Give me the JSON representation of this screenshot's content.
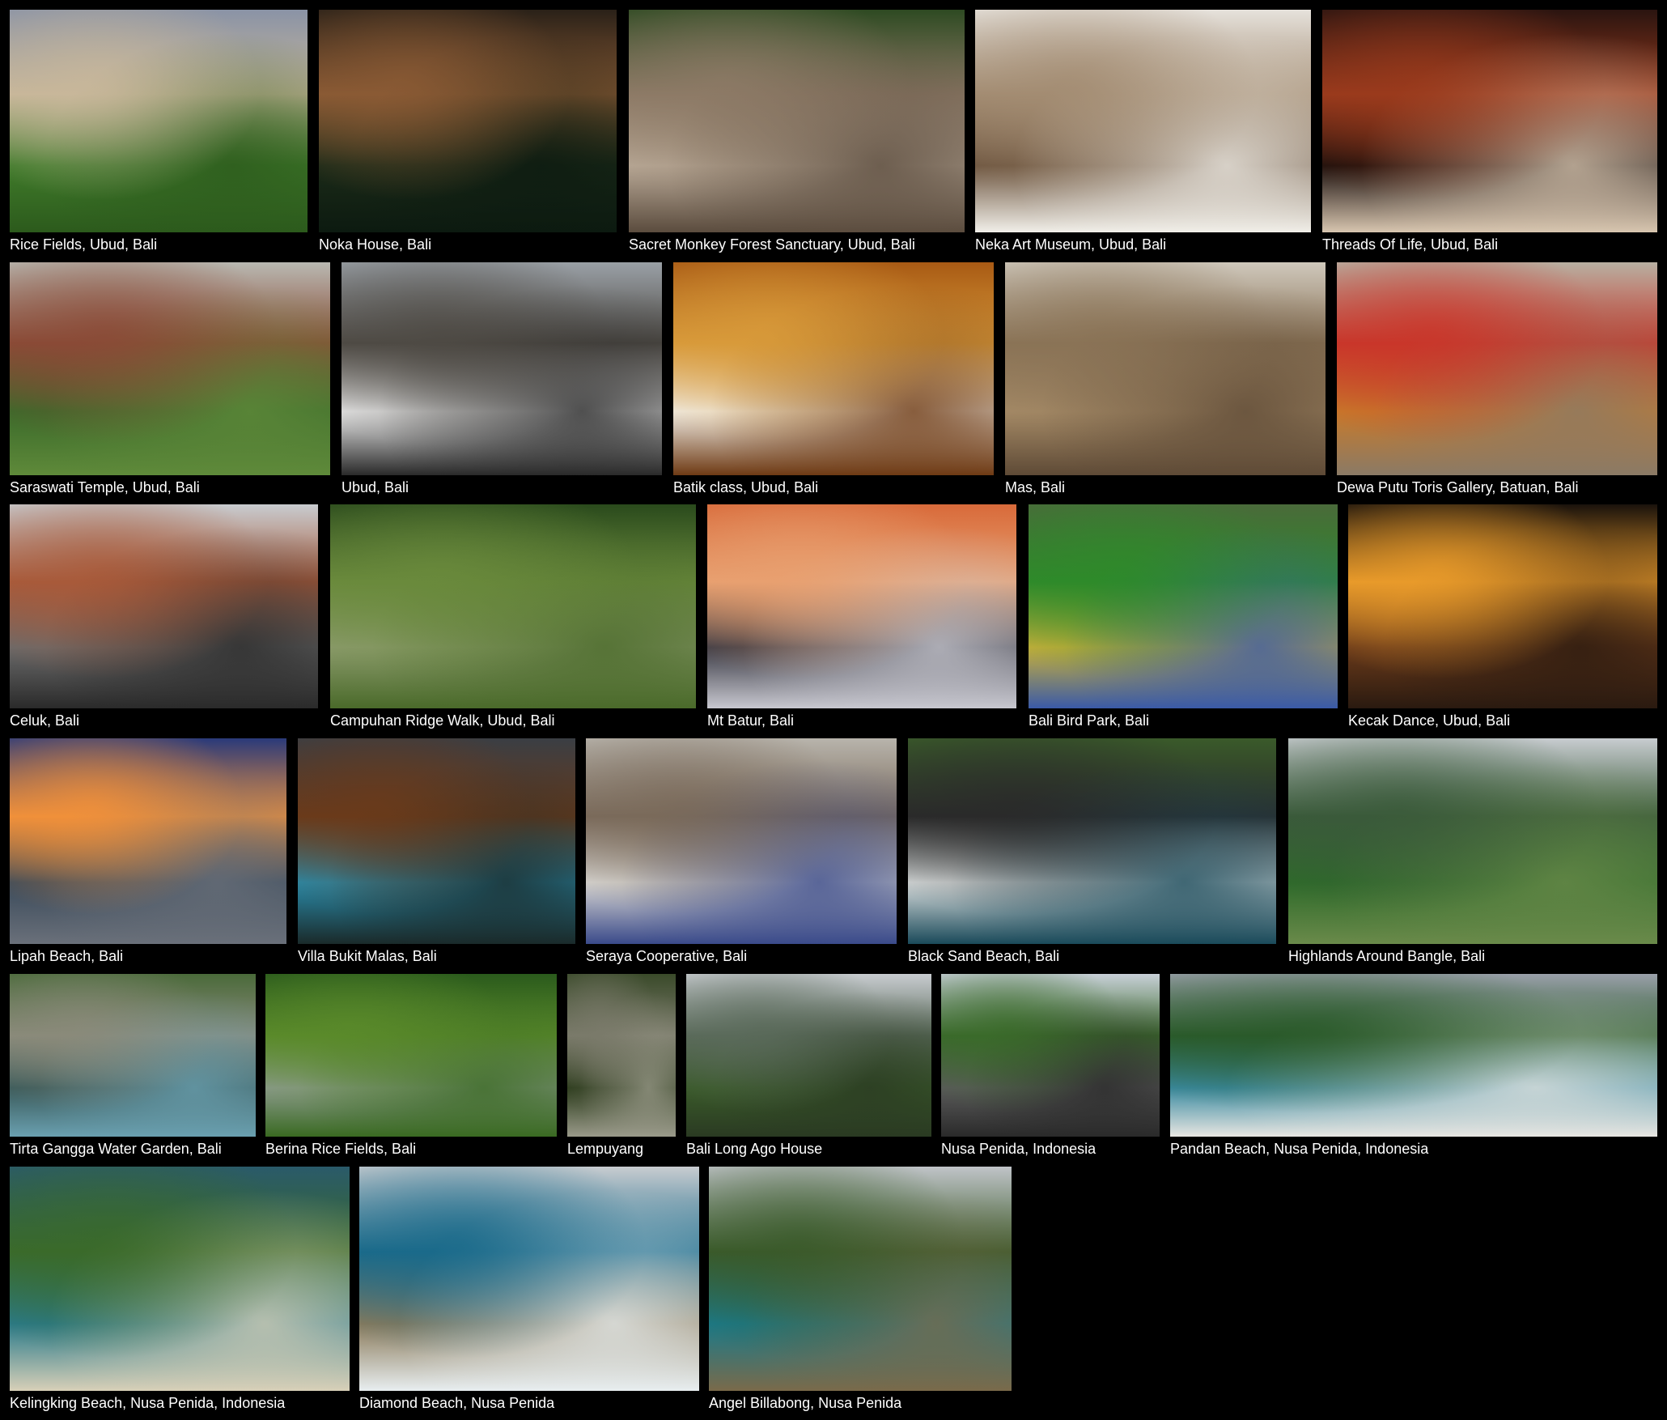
{
  "gallery": {
    "background": "#000000",
    "caption_color": "#ffffff",
    "rows": [
      {
        "tiles": [
          {
            "caption": "Rice Fields, Ubud, Bali",
            "colors": [
              "#8a93a6",
              "#c8b79a",
              "#3f7a2a",
              "#2c5a1c"
            ]
          },
          {
            "caption": "Noka House, Bali",
            "colors": [
              "#2a2118",
              "#8a5a34",
              "#1b2a18",
              "#0c1a10"
            ]
          },
          {
            "caption": "Sacret Monkey Forest Sanctuary, Ubud, Bali",
            "colors": [
              "#2e4a22",
              "#8d7a66",
              "#b8a896",
              "#5b4c3e"
            ]
          },
          {
            "caption": "Neka Art Museum, Ubud, Bali",
            "colors": [
              "#e6e2dc",
              "#a38c72",
              "#6e5640",
              "#f1efe9"
            ]
          },
          {
            "caption": "Threads Of Life, Ubud, Bali",
            "colors": [
              "#2a1410",
              "#9a3a1c",
              "#1a0f0c",
              "#d8c6b0"
            ]
          }
        ]
      },
      {
        "tiles": [
          {
            "caption": "Saraswati Temple, Ubud, Bali",
            "colors": [
              "#b9b9b2",
              "#8a4a36",
              "#3b6a2a",
              "#5f8a3a"
            ]
          },
          {
            "caption": "Ubud, Bali",
            "colors": [
              "#9aa0a6",
              "#4e4a44",
              "#e8e8e8",
              "#2a2a2a"
            ]
          },
          {
            "caption": "Batik class, Ubud, Bali",
            "colors": [
              "#a85a14",
              "#d89a3a",
              "#f0ece4",
              "#6e3a14"
            ]
          },
          {
            "caption": "Mas, Bali",
            "colors": [
              "#cfc8bc",
              "#8a7356",
              "#a58a66",
              "#5e4a36"
            ]
          },
          {
            "caption": "Dewa Putu Toris Gallery, Batuan, Bali",
            "colors": [
              "#b8b0a2",
              "#c9362a",
              "#c87a2a",
              "#8a7a66"
            ]
          }
        ]
      },
      {
        "tiles": [
          {
            "caption": "Celuk, Bali",
            "colors": [
              "#c8ccd0",
              "#a85a3a",
              "#6a6a6a",
              "#2a2a2a"
            ]
          },
          {
            "caption": "Campuhan Ridge Walk, Ubud, Bali",
            "colors": [
              "#2a4a1c",
              "#6a8a3c",
              "#8a9a6a",
              "#4a6a2a"
            ]
          },
          {
            "caption": "Mt Batur, Bali",
            "colors": [
              "#d86a3a",
              "#e8a070",
              "#3a3a44",
              "#c8c8d0"
            ]
          },
          {
            "caption": "Bali Bird Park, Bali",
            "colors": [
              "#4a6a3a",
              "#2e8a2a",
              "#c8b03a",
              "#3a5aa8"
            ]
          },
          {
            "caption": "Kecak Dance, Ubud, Bali",
            "colors": [
              "#1a120c",
              "#e89a2a",
              "#6a3a1a",
              "#2a1a10"
            ]
          }
        ]
      },
      {
        "tiles": [
          {
            "caption": "Lipah Beach, Bali",
            "colors": [
              "#2a3a7a",
              "#f0903a",
              "#3a4a5a",
              "#6a707a"
            ]
          },
          {
            "caption": "Villa Bukit Malas, Bali",
            "colors": [
              "#3a3e44",
              "#6a3a1a",
              "#2a8aa8",
              "#1a2a2a"
            ]
          },
          {
            "caption": "Seraya Cooperative, Bali",
            "colors": [
              "#b8b4ac",
              "#7a6a5a",
              "#d8d6d2",
              "#3a4a8a"
            ]
          },
          {
            "caption": "Black Sand Beach, Bali",
            "colors": [
              "#3a5a2a",
              "#2a2a2a",
              "#d8dcdc",
              "#1a4a5a"
            ]
          },
          {
            "caption": "Highlands Around Bangle, Bali",
            "colors": [
              "#c8ccd0",
              "#3a5a3a",
              "#2e6a2a",
              "#6a8a4a"
            ]
          }
        ]
      },
      {
        "tiles": [
          {
            "caption": "Tirta Gangga Water Garden, Bali",
            "colors": [
              "#4a6a3a",
              "#8a8a7a",
              "#3a5a5a",
              "#6aa0b0"
            ]
          },
          {
            "caption": "Berina Rice Fields, Bali",
            "colors": [
              "#2a5a1c",
              "#5a8a2a",
              "#8a9a8a",
              "#3a6a22"
            ]
          },
          {
            "caption": "Lempuyang",
            "colors": [
              "#3a4a2a",
              "#7a7a6a",
              "#2a3a1a",
              "#9a9a8a"
            ]
          },
          {
            "caption": "Bali Long Ago House",
            "colors": [
              "#c8ccd0",
              "#5a6a5a",
              "#3a5a2a",
              "#2a3a22"
            ]
          },
          {
            "caption": "Nusa Penida, Indonesia",
            "colors": [
              "#c8d0d8",
              "#3a6a2a",
              "#5a5a5a",
              "#2a2a2a"
            ]
          },
          {
            "caption": "Pandan Beach, Nusa Penida, Indonesia",
            "colors": [
              "#9aa0aa",
              "#2a5a2a",
              "#3a8aa0",
              "#e8e6e2"
            ]
          }
        ]
      },
      {
        "tiles": [
          {
            "caption": "Kelingking Beach, Nusa Penida, Indonesia",
            "colors": [
              "#2a5a6a",
              "#3a6a2a",
              "#2a7a8a",
              "#d8d0b8"
            ]
          },
          {
            "caption": "Diamond Beach, Nusa Penida",
            "colors": [
              "#c8ccd0",
              "#1a6a8a",
              "#8a7a5a",
              "#e8eef0"
            ]
          },
          {
            "caption": "Angel Billabong, Nusa Penida",
            "colors": [
              "#c0c4c8",
              "#3a5a2a",
              "#1a7a8a",
              "#7a6a4a"
            ]
          }
        ]
      }
    ]
  }
}
